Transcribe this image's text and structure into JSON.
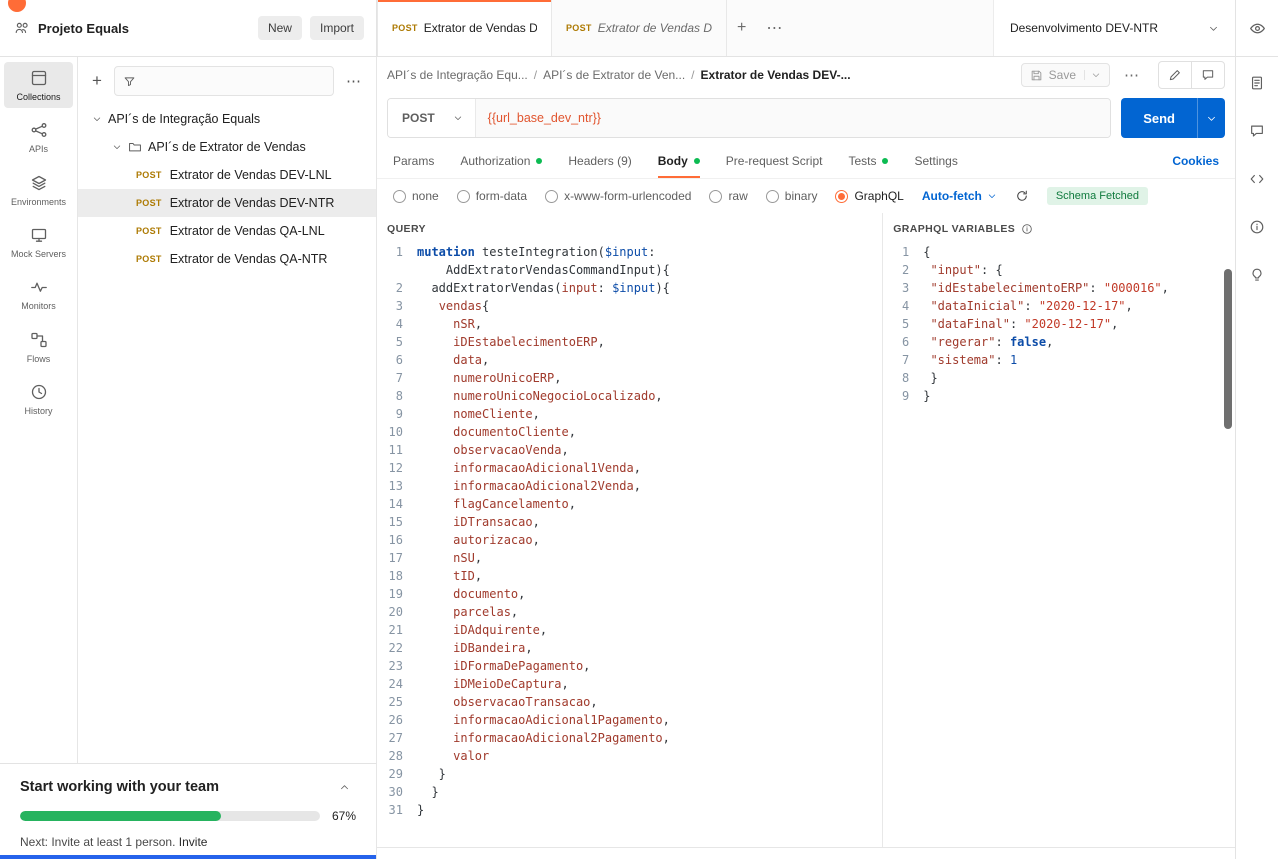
{
  "header": {
    "workspace_label": "Projeto Equals",
    "new_label": "New",
    "import_label": "Import",
    "env_label": "Desenvolvimento DEV-NTR"
  },
  "tabs": {
    "items": [
      {
        "method": "POST",
        "label": "Extrator de Vendas DEV"
      },
      {
        "method": "POST",
        "label": "Extrator de Vendas DEV"
      }
    ]
  },
  "rail": {
    "items": [
      "Collections",
      "APIs",
      "Environments",
      "Mock Servers",
      "Monitors",
      "Flows",
      "History"
    ]
  },
  "sidebar": {
    "root_label": "API´s de Integração Equals",
    "folder_label": "API´s de Extrator de Vendas",
    "requests": [
      {
        "method": "POST",
        "label": "Extrator de Vendas DEV-LNL"
      },
      {
        "method": "POST",
        "label": "Extrator de Vendas DEV-NTR"
      },
      {
        "method": "POST",
        "label": "Extrator de Vendas QA-LNL"
      },
      {
        "method": "POST",
        "label": "Extrator de Vendas QA-NTR"
      }
    ]
  },
  "breadcrumb": {
    "parts": [
      "API´s de Integração Equ...",
      "API´s de Extrator de Ven...",
      "Extrator de Vendas DEV-..."
    ],
    "save_label": "Save"
  },
  "request": {
    "method": "POST",
    "url": "{{url_base_dev_ntr}}",
    "send_label": "Send"
  },
  "request_tabs": {
    "items": [
      "Params",
      "Authorization",
      "Headers (9)",
      "Body",
      "Pre-request Script",
      "Tests",
      "Settings"
    ],
    "cookies_label": "Cookies"
  },
  "body_types": [
    "none",
    "form-data",
    "x-www-form-urlencoded",
    "raw",
    "binary",
    "GraphQL"
  ],
  "graphql": {
    "query_title": "QUERY",
    "variables_title": "GRAPHQL VARIABLES",
    "autofetch_label": "Auto-fetch",
    "schema_status": "Schema Fetched",
    "query_lines": [
      {
        "n": "1",
        "t": [
          [
            "k",
            "mutation "
          ],
          [
            "d",
            "testeIntegration("
          ],
          [
            "v",
            "$input"
          ],
          [
            "d",
            ":"
          ]
        ]
      },
      {
        "n": "",
        "t": [
          [
            "d",
            "    AddExtratorVendasCommandInput){"
          ]
        ]
      },
      {
        "n": "2",
        "t": [
          [
            "d",
            "  addExtratorVendas("
          ],
          [
            "f",
            "input"
          ],
          [
            "d",
            ": "
          ],
          [
            "v",
            "$input"
          ],
          [
            "d",
            "){"
          ]
        ]
      },
      {
        "n": "3",
        "t": [
          [
            "d",
            "   "
          ],
          [
            "f",
            "vendas"
          ],
          [
            "d",
            "{"
          ]
        ]
      },
      {
        "n": "4",
        "t": [
          [
            "d",
            "     "
          ],
          [
            "f",
            "nSR"
          ],
          [
            "d",
            ","
          ]
        ]
      },
      {
        "n": "5",
        "t": [
          [
            "d",
            "     "
          ],
          [
            "f",
            "iDEstabelecimentoERP"
          ],
          [
            "d",
            ","
          ]
        ]
      },
      {
        "n": "6",
        "t": [
          [
            "d",
            "     "
          ],
          [
            "f",
            "data"
          ],
          [
            "d",
            ","
          ]
        ]
      },
      {
        "n": "7",
        "t": [
          [
            "d",
            "     "
          ],
          [
            "f",
            "numeroUnicoERP"
          ],
          [
            "d",
            ","
          ]
        ]
      },
      {
        "n": "8",
        "t": [
          [
            "d",
            "     "
          ],
          [
            "f",
            "numeroUnicoNegocioLocalizado"
          ],
          [
            "d",
            ","
          ]
        ]
      },
      {
        "n": "9",
        "t": [
          [
            "d",
            "     "
          ],
          [
            "f",
            "nomeCliente"
          ],
          [
            "d",
            ","
          ]
        ]
      },
      {
        "n": "10",
        "t": [
          [
            "d",
            "     "
          ],
          [
            "f",
            "documentoCliente"
          ],
          [
            "d",
            ","
          ]
        ]
      },
      {
        "n": "11",
        "t": [
          [
            "d",
            "     "
          ],
          [
            "f",
            "observacaoVenda"
          ],
          [
            "d",
            ","
          ]
        ]
      },
      {
        "n": "12",
        "t": [
          [
            "d",
            "     "
          ],
          [
            "f",
            "informacaoAdicional1Venda"
          ],
          [
            "d",
            ","
          ]
        ]
      },
      {
        "n": "13",
        "t": [
          [
            "d",
            "     "
          ],
          [
            "f",
            "informacaoAdicional2Venda"
          ],
          [
            "d",
            ","
          ]
        ]
      },
      {
        "n": "14",
        "t": [
          [
            "d",
            "     "
          ],
          [
            "f",
            "flagCancelamento"
          ],
          [
            "d",
            ","
          ]
        ]
      },
      {
        "n": "15",
        "t": [
          [
            "d",
            "     "
          ],
          [
            "f",
            "iDTransacao"
          ],
          [
            "d",
            ","
          ]
        ]
      },
      {
        "n": "16",
        "t": [
          [
            "d",
            "     "
          ],
          [
            "f",
            "autorizacao"
          ],
          [
            "d",
            ","
          ]
        ]
      },
      {
        "n": "17",
        "t": [
          [
            "d",
            "     "
          ],
          [
            "f",
            "nSU"
          ],
          [
            "d",
            ","
          ]
        ]
      },
      {
        "n": "18",
        "t": [
          [
            "d",
            "     "
          ],
          [
            "f",
            "tID"
          ],
          [
            "d",
            ","
          ]
        ]
      },
      {
        "n": "19",
        "t": [
          [
            "d",
            "     "
          ],
          [
            "f",
            "documento"
          ],
          [
            "d",
            ","
          ]
        ]
      },
      {
        "n": "20",
        "t": [
          [
            "d",
            "     "
          ],
          [
            "f",
            "parcelas"
          ],
          [
            "d",
            ","
          ]
        ]
      },
      {
        "n": "21",
        "t": [
          [
            "d",
            "     "
          ],
          [
            "f",
            "iDAdquirente"
          ],
          [
            "d",
            ","
          ]
        ]
      },
      {
        "n": "22",
        "t": [
          [
            "d",
            "     "
          ],
          [
            "f",
            "iDBandeira"
          ],
          [
            "d",
            ","
          ]
        ]
      },
      {
        "n": "23",
        "t": [
          [
            "d",
            "     "
          ],
          [
            "f",
            "iDFormaDePagamento"
          ],
          [
            "d",
            ","
          ]
        ]
      },
      {
        "n": "24",
        "t": [
          [
            "d",
            "     "
          ],
          [
            "f",
            "iDMeioDeCaptura"
          ],
          [
            "d",
            ","
          ]
        ]
      },
      {
        "n": "25",
        "t": [
          [
            "d",
            "     "
          ],
          [
            "f",
            "observacaoTransacao"
          ],
          [
            "d",
            ","
          ]
        ]
      },
      {
        "n": "26",
        "t": [
          [
            "d",
            "     "
          ],
          [
            "f",
            "informacaoAdicional1Pagamento"
          ],
          [
            "d",
            ","
          ]
        ]
      },
      {
        "n": "27",
        "t": [
          [
            "d",
            "     "
          ],
          [
            "f",
            "informacaoAdicional2Pagamento"
          ],
          [
            "d",
            ","
          ]
        ]
      },
      {
        "n": "28",
        "t": [
          [
            "d",
            "     "
          ],
          [
            "f",
            "valor"
          ]
        ]
      },
      {
        "n": "29",
        "t": [
          [
            "d",
            "   }"
          ]
        ]
      },
      {
        "n": "30",
        "t": [
          [
            "d",
            "  }"
          ]
        ]
      },
      {
        "n": "31",
        "t": [
          [
            "d",
            "}"
          ]
        ]
      }
    ],
    "variables_lines": [
      {
        "n": "1",
        "t": [
          [
            "d",
            "{"
          ]
        ]
      },
      {
        "n": "2",
        "t": [
          [
            "d",
            " "
          ],
          [
            "f",
            "\"input\""
          ],
          [
            "d",
            ": {"
          ]
        ]
      },
      {
        "n": "3",
        "t": [
          [
            "d",
            " "
          ],
          [
            "f",
            "\"idEstabelecimentoERP\""
          ],
          [
            "d",
            ": "
          ],
          [
            "s",
            "\"000016\""
          ],
          [
            "d",
            ","
          ]
        ]
      },
      {
        "n": "4",
        "t": [
          [
            "d",
            " "
          ],
          [
            "f",
            "\"dataInicial\""
          ],
          [
            "d",
            ": "
          ],
          [
            "s",
            "\"2020-12-17\""
          ],
          [
            "d",
            ","
          ]
        ]
      },
      {
        "n": "5",
        "t": [
          [
            "d",
            " "
          ],
          [
            "f",
            "\"dataFinal\""
          ],
          [
            "d",
            ": "
          ],
          [
            "s",
            "\"2020-12-17\""
          ],
          [
            "d",
            ","
          ]
        ]
      },
      {
        "n": "6",
        "t": [
          [
            "d",
            " "
          ],
          [
            "f",
            "\"regerar\""
          ],
          [
            "d",
            ": "
          ],
          [
            "b",
            "false"
          ],
          [
            "d",
            ","
          ]
        ]
      },
      {
        "n": "7",
        "t": [
          [
            "d",
            " "
          ],
          [
            "f",
            "\"sistema\""
          ],
          [
            "d",
            ": "
          ],
          [
            "nm",
            "1"
          ]
        ]
      },
      {
        "n": "8",
        "t": [
          [
            "d",
            " }"
          ]
        ]
      },
      {
        "n": "9",
        "t": [
          [
            "d",
            "}"
          ]
        ]
      }
    ]
  },
  "team_banner": {
    "title": "Start working with your team",
    "progress_value": 67,
    "progress_pct": "67%",
    "next_prefix": "Next: Invite at least 1 person.",
    "invite_label": "Invite"
  }
}
